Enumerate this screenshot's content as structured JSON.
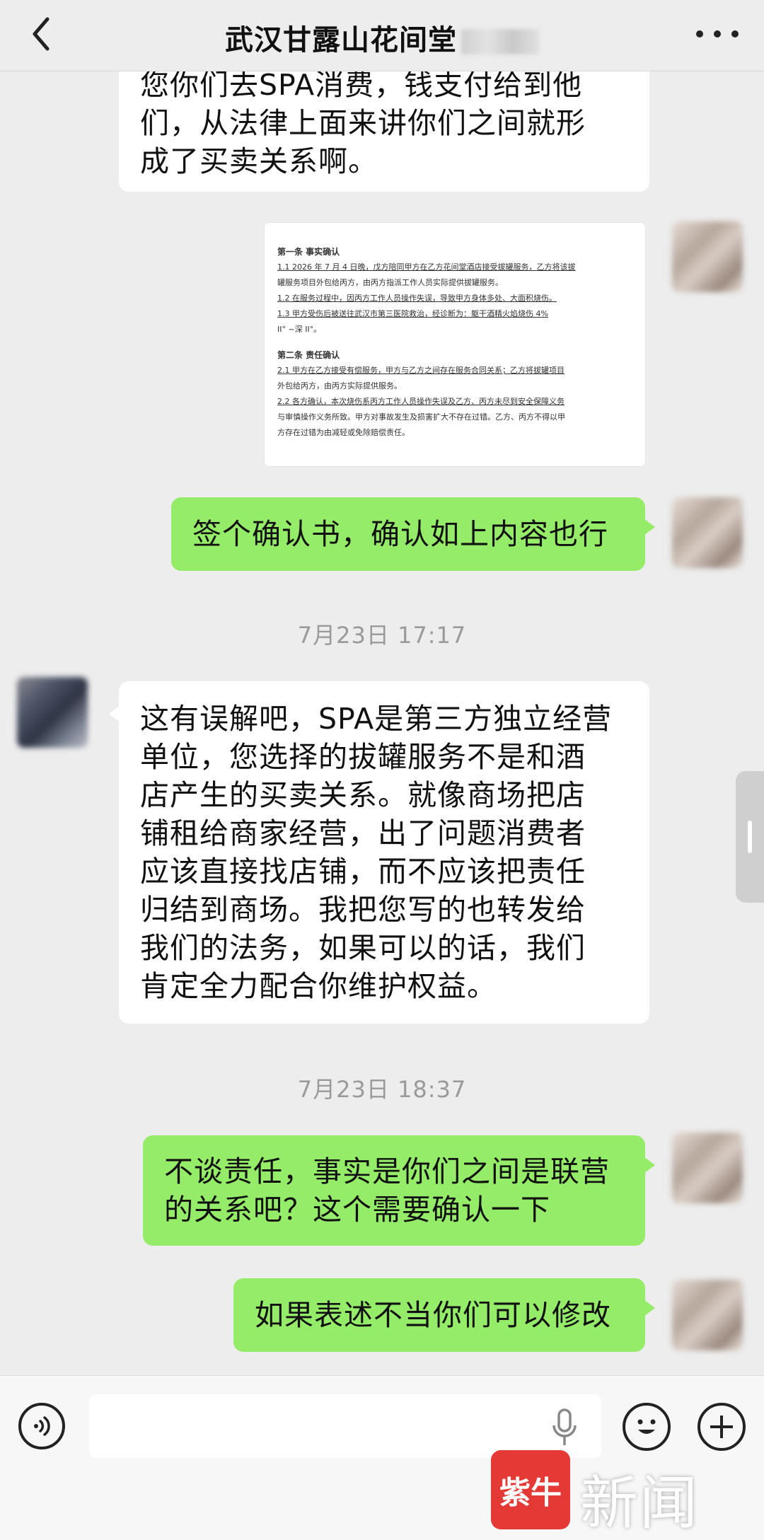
{
  "header": {
    "title": "武汉甘露山花间堂"
  },
  "messages": {
    "m1_lines": [
      "您你们去SPA消费，钱支付给到他",
      "们，从法律上面来讲你们之间就形",
      "成了买卖关系啊。"
    ],
    "doc": {
      "sec1_title": "第一条  事实确认",
      "l1": "1.1  2026 年 7 月 4 日晚，戊方陪同甲方在乙方花间堂酒店接受拔罐服务，乙方将该拔",
      "l2": "罐服务项目外包给丙方，由丙方指派工作人员实际提供拔罐服务。",
      "l3": "1.2  在服务过程中，因丙方工作人员操作失误，导致甲方身体多处、大面积烧伤。",
      "l4": "1.3  甲方受伤后被送往武汉市第三医院救治，经诊断为：躯干酒精火焰烧伤 4%",
      "l5": "II° ~深 II°。",
      "sec2_title": "第二条  责任确认",
      "l6": "2.1  甲方在乙方接受有偿服务，甲方与乙方之间存在服务合同关系；乙方将拔罐项目",
      "l7": "外包给丙方，由丙方实际提供服务。",
      "l8": "2.2  各方确认，本次烧伤系丙方工作人员操作失误及乙方、丙方未尽到安全保障义务",
      "l9": "与审慎操作义务所致。甲方对事故发生及损害扩大不存在过错。乙方、丙方不得以甲",
      "l10": "方存在过错为由减轻或免除赔偿责任。"
    },
    "m3": "签个确认书，确认如上内容也行",
    "ts1": "7月23日 17:17",
    "m4_lines": [
      "这有误解吧，SPA是第三方独立经营",
      "单位，您选择的拔罐服务不是和酒",
      "店产生的买卖关系。就像商场把店",
      "铺租给商家经营，出了问题消费者",
      "应该直接找店铺，而不应该把责任",
      "归结到商场。我把您写的也转发给",
      "我们的法务，如果可以的话，我们",
      "肯定全力配合你维护权益。"
    ],
    "ts2": "7月23日 18:37",
    "m5_lines": [
      "不谈责任，事实是你们之间是联营",
      "的关系吧？这个需要确认一下"
    ],
    "m6": "如果表述不当你们可以修改"
  },
  "watermark": {
    "logo": "紫牛",
    "text": "新闻"
  },
  "colors": {
    "background": "#ededed",
    "sent_bubble": "#95ec69",
    "received_bubble": "#ffffff",
    "watermark_red": "#e53935"
  },
  "icons": [
    "back-arrow-icon",
    "more-dots-icon",
    "voice-icon",
    "mic-icon",
    "emoji-icon",
    "plus-icon"
  ]
}
